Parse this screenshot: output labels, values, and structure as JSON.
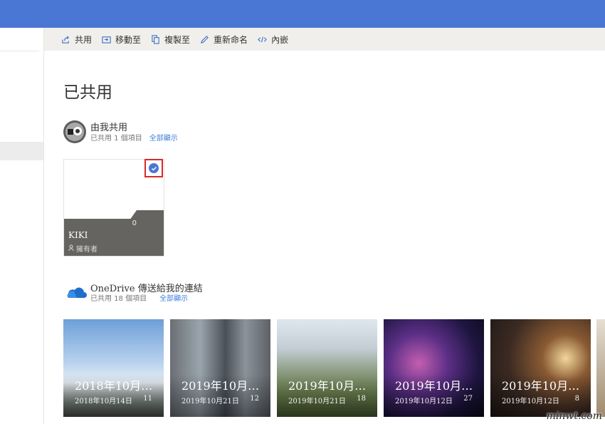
{
  "commandbar": {
    "items": [
      {
        "label": "共用",
        "icon": "share-icon"
      },
      {
        "label": "移動至",
        "icon": "move-to-icon"
      },
      {
        "label": "複製至",
        "icon": "copy-to-icon"
      },
      {
        "label": "重新命名",
        "icon": "rename-icon"
      },
      {
        "label": "內嵌",
        "icon": "embed-icon"
      }
    ]
  },
  "page": {
    "title": "已共用"
  },
  "shared_by_me": {
    "title": "由我共用",
    "subtitle": "已共用 1 個項目",
    "show_all": "全部顯示",
    "folder": {
      "name": "KIKI",
      "count": "0",
      "role": "擁有者",
      "checked": true
    }
  },
  "onedrive_links": {
    "title": "OneDrive 傳送給我的連結",
    "subtitle": "已共用 18 個項目",
    "show_all": "全部顯示",
    "albums": [
      {
        "title": "2018年10月…",
        "date": "2018年10月14日",
        "count": "11"
      },
      {
        "title": "2019年10月…",
        "date": "2019年10月21日",
        "count": "12"
      },
      {
        "title": "2019年10月…",
        "date": "2019年10月21日",
        "count": "18"
      },
      {
        "title": "2019年10月…",
        "date": "2019年10月12日",
        "count": "27"
      },
      {
        "title": "2019年10月…",
        "date": "2019年10月12日",
        "count": "8"
      }
    ]
  },
  "watermark": "minwt.com",
  "colors": {
    "accent": "#4a76d4",
    "highlight": "#d62a2a"
  }
}
